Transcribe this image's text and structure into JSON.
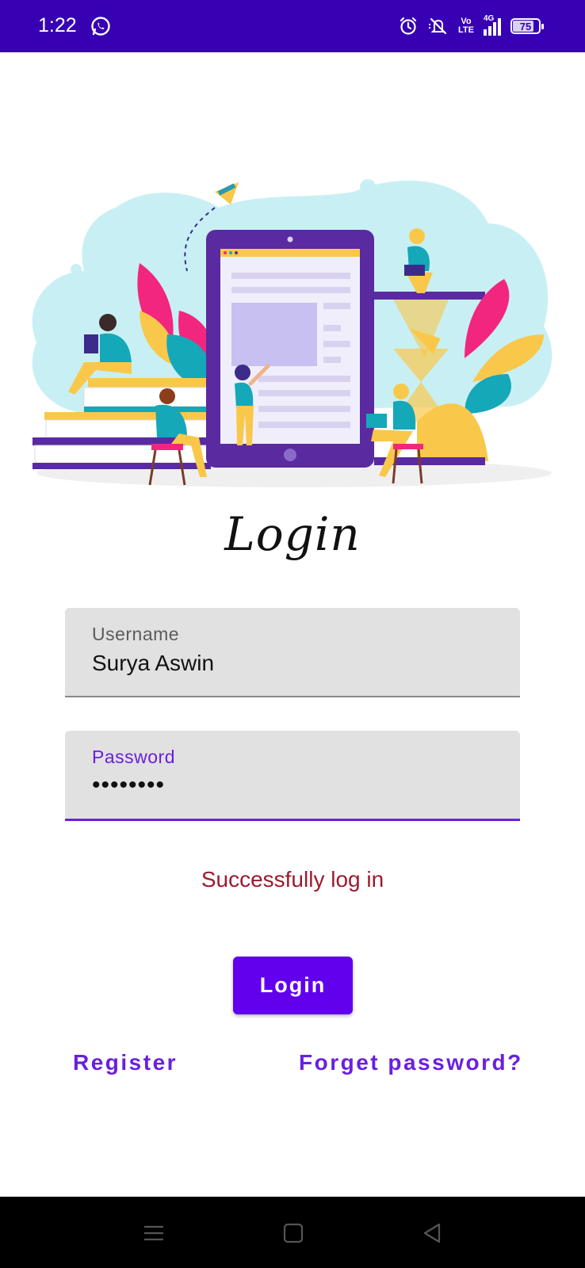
{
  "status_bar": {
    "time": "1:22",
    "battery": "75",
    "battery_level": 0.75,
    "network": "4G",
    "volte": "Vo LTE",
    "icons": [
      "whatsapp-icon",
      "alarm-icon",
      "mute-icon",
      "volte-icon",
      "signal-icon",
      "battery-icon"
    ],
    "background": "#3700b3"
  },
  "hero": {
    "icon": "illustration-people-tablet"
  },
  "title": "Login",
  "form": {
    "username": {
      "label": "Username",
      "value": "Surya Aswin"
    },
    "password": {
      "label": "Password",
      "value": "••••••••"
    }
  },
  "status_message": "Successfully log in",
  "login_button": "Login",
  "links": {
    "register": "Register",
    "forget_password": "Forget password?"
  },
  "nav_bar": {
    "icons": [
      "menu-icon",
      "home-icon",
      "back-icon"
    ]
  },
  "colors": {
    "accent": "#6200ee",
    "link": "#6a1fe0",
    "message": "#9b1b2f",
    "field_bg": "#e1e1e1"
  }
}
